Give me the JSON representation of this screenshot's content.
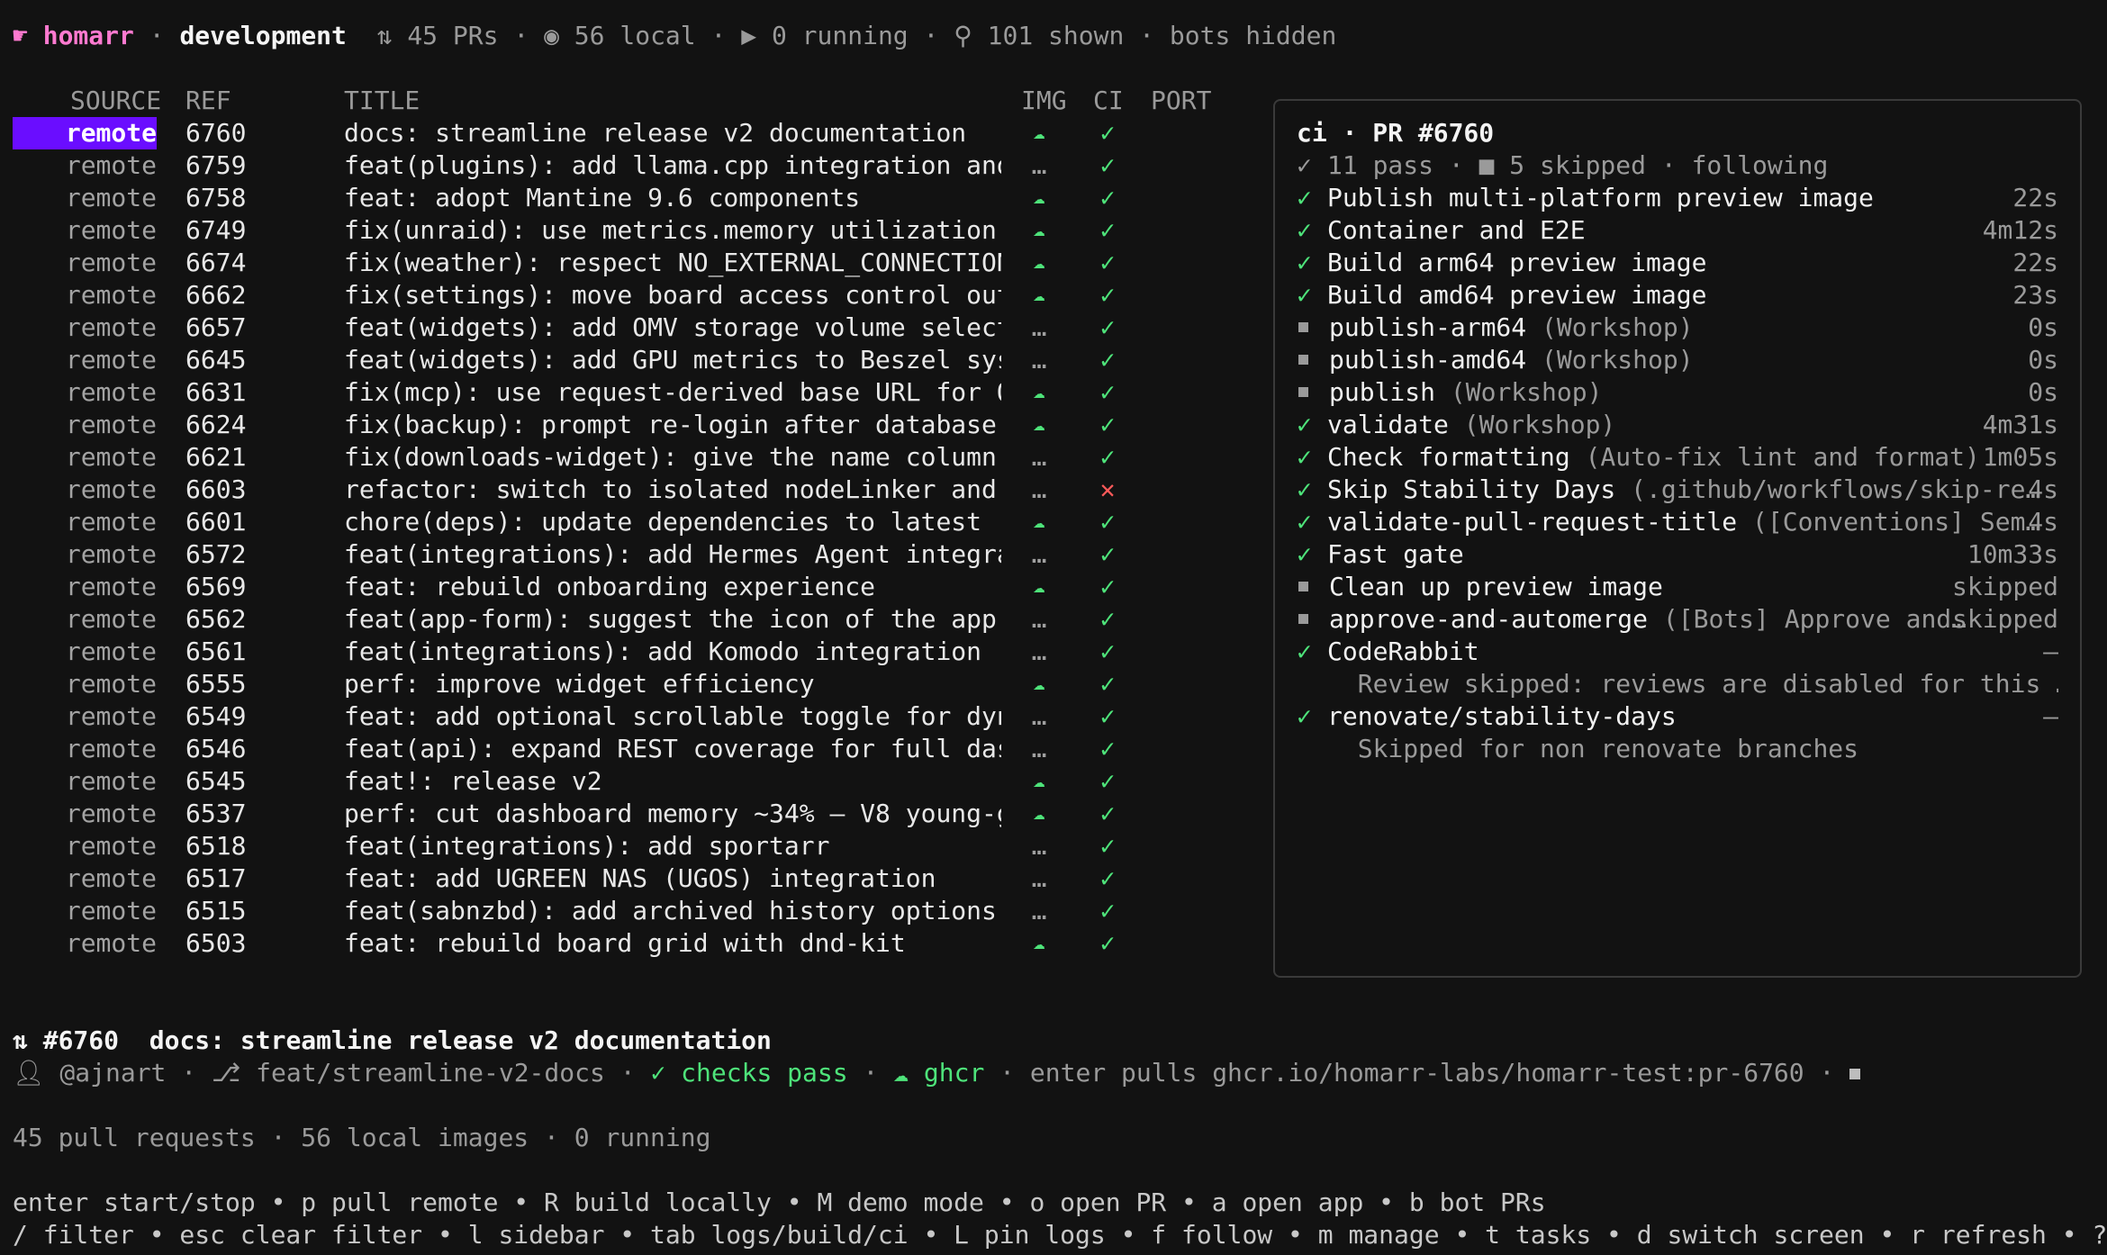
{
  "header": {
    "app": "homarr",
    "branch": "development",
    "prs": "45 PRs",
    "local": "56 local",
    "running": "0 running",
    "shown": "101 shown",
    "bots": "bots hidden"
  },
  "columns": [
    "SOURCE",
    "REF",
    "TITLE",
    "IMG",
    "CI",
    "PORT"
  ],
  "rows": [
    {
      "source": "remote",
      "ref": "6760",
      "title": "docs: streamline release v2 documentation",
      "img": "cloud",
      "ci": "pass",
      "selected": true
    },
    {
      "source": "remote",
      "ref": "6759",
      "title": "feat(plugins): add llama.cpp integration and…",
      "img": "…",
      "ci": "pass"
    },
    {
      "source": "remote",
      "ref": "6758",
      "title": "feat: adopt Mantine 9.6 components",
      "img": "cloud",
      "ci": "pass"
    },
    {
      "source": "remote",
      "ref": "6749",
      "title": "fix(unraid): use metrics.memory utilization …",
      "img": "cloud",
      "ci": "pass"
    },
    {
      "source": "remote",
      "ref": "6674",
      "title": "fix(weather): respect NO_EXTERNAL_CONNECTION…",
      "img": "cloud",
      "ci": "pass"
    },
    {
      "source": "remote",
      "ref": "6662",
      "title": "fix(settings): move board access control out…",
      "img": "cloud",
      "ci": "pass"
    },
    {
      "source": "remote",
      "ref": "6657",
      "title": "feat(widgets): add OMV storage volume select…",
      "img": "…",
      "ci": "pass"
    },
    {
      "source": "remote",
      "ref": "6645",
      "title": "feat(widgets): add GPU metrics to Beszel sys…",
      "img": "…",
      "ci": "pass"
    },
    {
      "source": "remote",
      "ref": "6631",
      "title": "fix(mcp): use request-derived base URL for O…",
      "img": "cloud",
      "ci": "pass"
    },
    {
      "source": "remote",
      "ref": "6624",
      "title": "fix(backup): prompt re-login after database …",
      "img": "cloud",
      "ci": "pass"
    },
    {
      "source": "remote",
      "ref": "6621",
      "title": "fix(downloads-widget): give the name column …",
      "img": "…",
      "ci": "pass"
    },
    {
      "source": "remote",
      "ref": "6603",
      "title": "refactor: switch to isolated nodeLinker and …",
      "img": "…",
      "ci": "fail"
    },
    {
      "source": "remote",
      "ref": "6601",
      "title": "chore(deps): update dependencies to latest (…",
      "img": "cloud",
      "ci": "pass"
    },
    {
      "source": "remote",
      "ref": "6572",
      "title": "feat(integrations): add Hermes Agent integra…",
      "img": "…",
      "ci": "pass"
    },
    {
      "source": "remote",
      "ref": "6569",
      "title": "feat: rebuild onboarding experience",
      "img": "cloud",
      "ci": "pass"
    },
    {
      "source": "remote",
      "ref": "6562",
      "title": "feat(app-form): suggest the icon of the app …",
      "img": "…",
      "ci": "pass"
    },
    {
      "source": "remote",
      "ref": "6561",
      "title": "feat(integrations): add Komodo integration",
      "img": "…",
      "ci": "pass"
    },
    {
      "source": "remote",
      "ref": "6555",
      "title": "perf: improve widget efficiency",
      "img": "cloud",
      "ci": "pass"
    },
    {
      "source": "remote",
      "ref": "6549",
      "title": "feat: add optional scrollable toggle for dyn…",
      "img": "…",
      "ci": "pass"
    },
    {
      "source": "remote",
      "ref": "6546",
      "title": "feat(api): expand REST coverage for full das…",
      "img": "…",
      "ci": "pass"
    },
    {
      "source": "remote",
      "ref": "6545",
      "title": "feat!: release v2",
      "img": "cloud",
      "ci": "pass"
    },
    {
      "source": "remote",
      "ref": "6537",
      "title": "perf: cut dashboard memory ~34% — V8 young-g…",
      "img": "cloud",
      "ci": "pass"
    },
    {
      "source": "remote",
      "ref": "6518",
      "title": "feat(integrations): add sportarr",
      "img": "…",
      "ci": "pass"
    },
    {
      "source": "remote",
      "ref": "6517",
      "title": "feat: add UGREEN NAS (UGOS) integration",
      "img": "…",
      "ci": "pass"
    },
    {
      "source": "remote",
      "ref": "6515",
      "title": "feat(sabnzbd): add archived history options …",
      "img": "…",
      "ci": "pass"
    },
    {
      "source": "remote",
      "ref": "6503",
      "title": "feat: rebuild board grid with dnd-kit",
      "img": "cloud",
      "ci": "pass"
    }
  ],
  "ci_panel": {
    "title": "ci · PR #6760",
    "summary": "11 pass · ■ 5 skipped · following",
    "checks": [
      {
        "status": "pass",
        "name": "Publish multi-platform preview image",
        "context": "",
        "duration": "22s"
      },
      {
        "status": "pass",
        "name": "Container and E2E",
        "context": "",
        "duration": "4m12s"
      },
      {
        "status": "pass",
        "name": "Build arm64 preview image",
        "context": "",
        "duration": "22s"
      },
      {
        "status": "pass",
        "name": "Build amd64 preview image",
        "context": "",
        "duration": "23s"
      },
      {
        "status": "skip",
        "name": "publish-arm64",
        "context": " (Workshop)",
        "duration": "0s"
      },
      {
        "status": "skip",
        "name": "publish-amd64",
        "context": " (Workshop)",
        "duration": "0s"
      },
      {
        "status": "skip",
        "name": "publish",
        "context": " (Workshop)",
        "duration": "0s"
      },
      {
        "status": "pass",
        "name": "validate",
        "context": " (Workshop)",
        "duration": "4m31s"
      },
      {
        "status": "pass",
        "name": "Check formatting",
        "context": " (Auto-fix lint and format)",
        "duration": "1m05s"
      },
      {
        "status": "pass",
        "name": "Skip Stability Days",
        "context": " (.github/workflows/skip-re…",
        "duration": "4s"
      },
      {
        "status": "pass",
        "name": "validate-pull-request-title",
        "context": " ([Conventions] Sem…",
        "duration": "4s"
      },
      {
        "status": "pass",
        "name": "Fast gate",
        "context": "",
        "duration": "10m33s"
      },
      {
        "status": "skip",
        "name": "Clean up preview image",
        "context": "",
        "duration": "skipped"
      },
      {
        "status": "skip",
        "name": "approve-and-automerge",
        "context": " ([Bots] Approve and…",
        "duration": "skipped"
      },
      {
        "status": "pass",
        "name": "CodeRabbit",
        "context": "",
        "duration": "—"
      },
      {
        "status": "note",
        "name": "",
        "context": "  Review skipped: reviews are disabled for this …",
        "duration": ""
      },
      {
        "status": "pass",
        "name": "renovate/stability-days",
        "context": "",
        "duration": "—"
      },
      {
        "status": "note",
        "name": "",
        "context": "  Skipped for non renovate branches",
        "duration": ""
      }
    ]
  },
  "detail": {
    "pr": "#6760",
    "title": "docs: streamline release v2 documentation",
    "author": "@ajnart",
    "branch": "feat/streamline-v2-docs",
    "checks": "checks pass",
    "registry": "ghcr",
    "hint": "enter pulls ghcr.io/homarr-labs/homarr-test:pr-6760"
  },
  "status_line": "45 pull requests · 56 local images · 0 running",
  "help": {
    "line1": "enter start/stop • p pull remote • R build locally • M demo mode • o open PR • a open app • b bot PRs",
    "line2": "/ filter • esc clear filter • l sidebar • tab logs/build/ci • L pin logs • f follow • m manage • t tasks • d switch screen • r refresh • ? help"
  },
  "colors": {
    "accent": "#6a0dff",
    "pass": "#4ee37a",
    "fail": "#ff5a5a",
    "brand": "#ff7ad0"
  }
}
